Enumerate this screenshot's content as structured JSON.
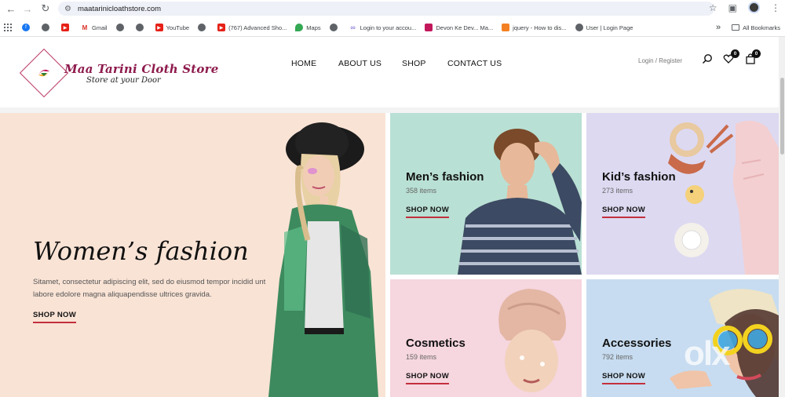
{
  "browser": {
    "url": "maatarinicloathstore.com",
    "url_display": "maatarinicloathstore.com"
  },
  "bookmarks": {
    "items": [
      {
        "label": "",
        "icon": "facebook-icon"
      },
      {
        "label": "",
        "icon": "globe-icon"
      },
      {
        "label": "",
        "icon": "youtube-icon"
      },
      {
        "label": "Gmail",
        "icon": "gmail-icon"
      },
      {
        "label": "",
        "icon": "globe-icon"
      },
      {
        "label": "",
        "icon": "globe-icon"
      },
      {
        "label": "YouTube",
        "icon": "youtube-icon"
      },
      {
        "label": "",
        "icon": "globe-icon"
      },
      {
        "label": "(767) Advanced Sho...",
        "icon": "youtube-icon"
      },
      {
        "label": "Maps",
        "icon": "maps-icon"
      },
      {
        "label": "",
        "icon": "globe-icon"
      },
      {
        "label": "Login to your accou...",
        "icon": "link-icon"
      },
      {
        "label": "Devon Ke Dev... Ma...",
        "icon": "bookmark-icon"
      },
      {
        "label": "jquery - How to dis...",
        "icon": "stackoverflow-icon"
      },
      {
        "label": "User | Login Page",
        "icon": "globe-icon"
      }
    ],
    "overflow": "»",
    "all_bookmarks": "All Bookmarks"
  },
  "site": {
    "logo_title": "Maa Tarini Cloth Store",
    "logo_subtitle": "Store at your Door",
    "nav": {
      "home": "HOME",
      "about": "ABOUT US",
      "shop": "SHOP",
      "contact": "CONTACT US"
    },
    "login": "Login / Register",
    "wishlist_count": "0",
    "cart_count": "0"
  },
  "banners": {
    "women": {
      "title": "Women’s fashion",
      "description": "Sitamet, consectetur adipiscing elit, sed do eiusmod tempor incidid unt labore edolore magna aliquapendisse ultrices gravida.",
      "shop": "SHOP NOW"
    },
    "men": {
      "title": "Men’s fashion",
      "count": "358 items",
      "shop": "SHOP NOW"
    },
    "kid": {
      "title": "Kid’s fashion",
      "count": "273 items",
      "shop": "SHOP NOW"
    },
    "cosmetics": {
      "title": "Cosmetics",
      "count": "159 items",
      "shop": "SHOP NOW"
    },
    "accessories": {
      "title": "Accessories",
      "count": "792 items",
      "shop": "SHOP NOW"
    }
  },
  "watermark": "olx",
  "colors": {
    "brand": "#8e1b4d",
    "accent_underline": "#c3303d",
    "women_bg": "#f9e3d5",
    "men_bg": "#b9e0d4",
    "kid_bg": "#ddd9f1",
    "cosmetics_bg": "#f6d6df",
    "accessories_bg": "#c7dcf0"
  }
}
